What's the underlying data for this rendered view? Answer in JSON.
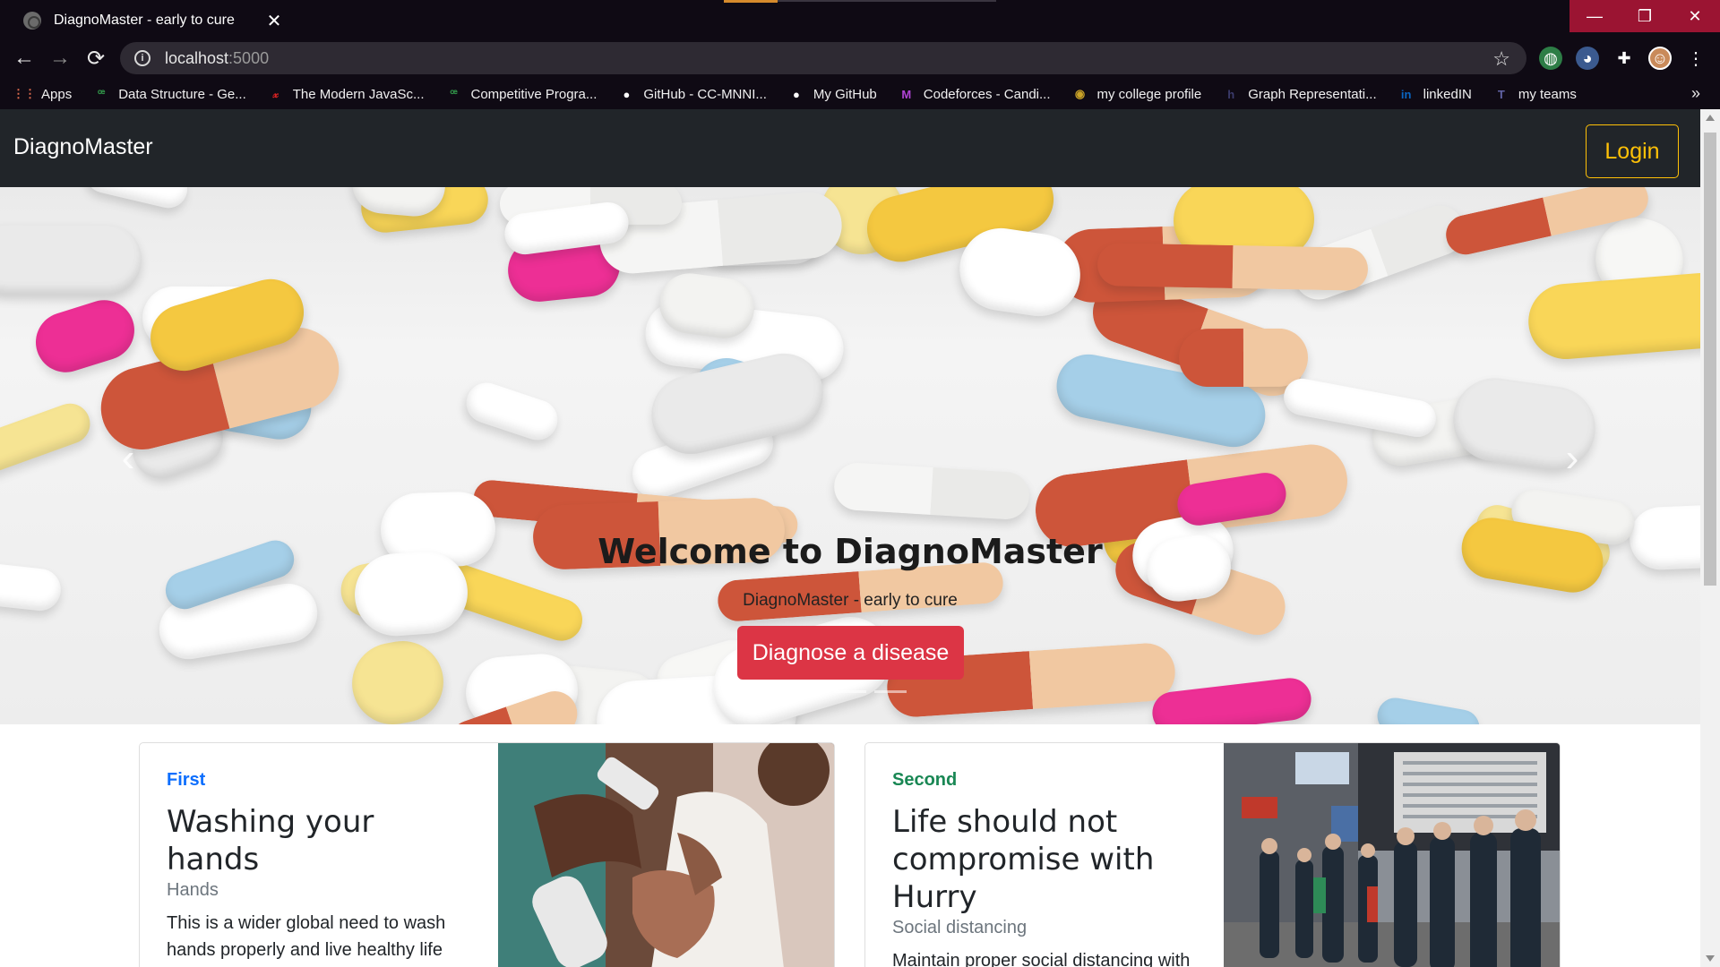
{
  "browser": {
    "tab_title": "DiagnoMaster - early to cure",
    "tab_close": "✕",
    "url_host": "localhost",
    "url_port": ":5000",
    "window_controls": [
      "—",
      "❐",
      "✕"
    ],
    "nav_icons": {
      "back": "←",
      "forward": "→",
      "reload": "⟳"
    },
    "bookmarks": [
      {
        "label": "Apps",
        "icon": "apps-grid-icon",
        "glyph": "⋮⋮",
        "color": "#e06c4f"
      },
      {
        "label": "Data Structure - Ge...",
        "icon": "geeksforgeeks-icon",
        "glyph": "ꟹ",
        "color": "#2f8d46"
      },
      {
        "label": "The Modern JavaSc...",
        "icon": "javascript-info-icon",
        "glyph": "𝓍",
        "color": "#d22"
      },
      {
        "label": "Competitive Progra...",
        "icon": "geeksforgeeks-icon",
        "glyph": "ꟹ",
        "color": "#2f8d46"
      },
      {
        "label": "GitHub - CC-MNNI...",
        "icon": "github-icon",
        "glyph": "●",
        "color": "#ffffff"
      },
      {
        "label": "My GitHub",
        "icon": "github-icon",
        "glyph": "●",
        "color": "#ffffff"
      },
      {
        "label": "Codeforces - Candi...",
        "icon": "codeforces-icon",
        "glyph": "M",
        "color": "#b144d6"
      },
      {
        "label": "my college profile",
        "icon": "college-icon",
        "glyph": "◉",
        "color": "#c9a227"
      },
      {
        "label": "Graph Representati...",
        "icon": "hackerearth-icon",
        "glyph": "h",
        "color": "#3b3b6b"
      },
      {
        "label": "linkedIN",
        "icon": "linkedin-icon",
        "glyph": "in",
        "color": "#0a66c2"
      },
      {
        "label": "my teams",
        "icon": "teams-icon",
        "glyph": "T",
        "color": "#6264a7"
      }
    ],
    "bookmarks_more": "»"
  },
  "navbar": {
    "brand": "DiagnoMaster",
    "login": "Login"
  },
  "hero": {
    "title": "Welcome to DiagnoMaster",
    "subtitle": "DiagnoMaster - early to cure",
    "cta": "Diagnose a disease",
    "prev": "‹",
    "next": "›",
    "slide_count": 3,
    "active_slide": 1
  },
  "cards": [
    {
      "label": "First",
      "label_color": "#0d6efd",
      "title": "Washing your hands",
      "subtitle": "Hands",
      "text": "This is a wider global need to wash hands properly and live healthy life with positive attitude and lifestyle."
    },
    {
      "label": "Second",
      "label_color": "#198754",
      "title": "Life should not compromise with Hurry",
      "subtitle": "Social distancing",
      "text": "Maintain proper social distancing with"
    }
  ],
  "colors": {
    "chrome": "#0f0a14",
    "navbar": "#212529",
    "login_accent": "#ffc107",
    "cta": "#dc3545"
  }
}
